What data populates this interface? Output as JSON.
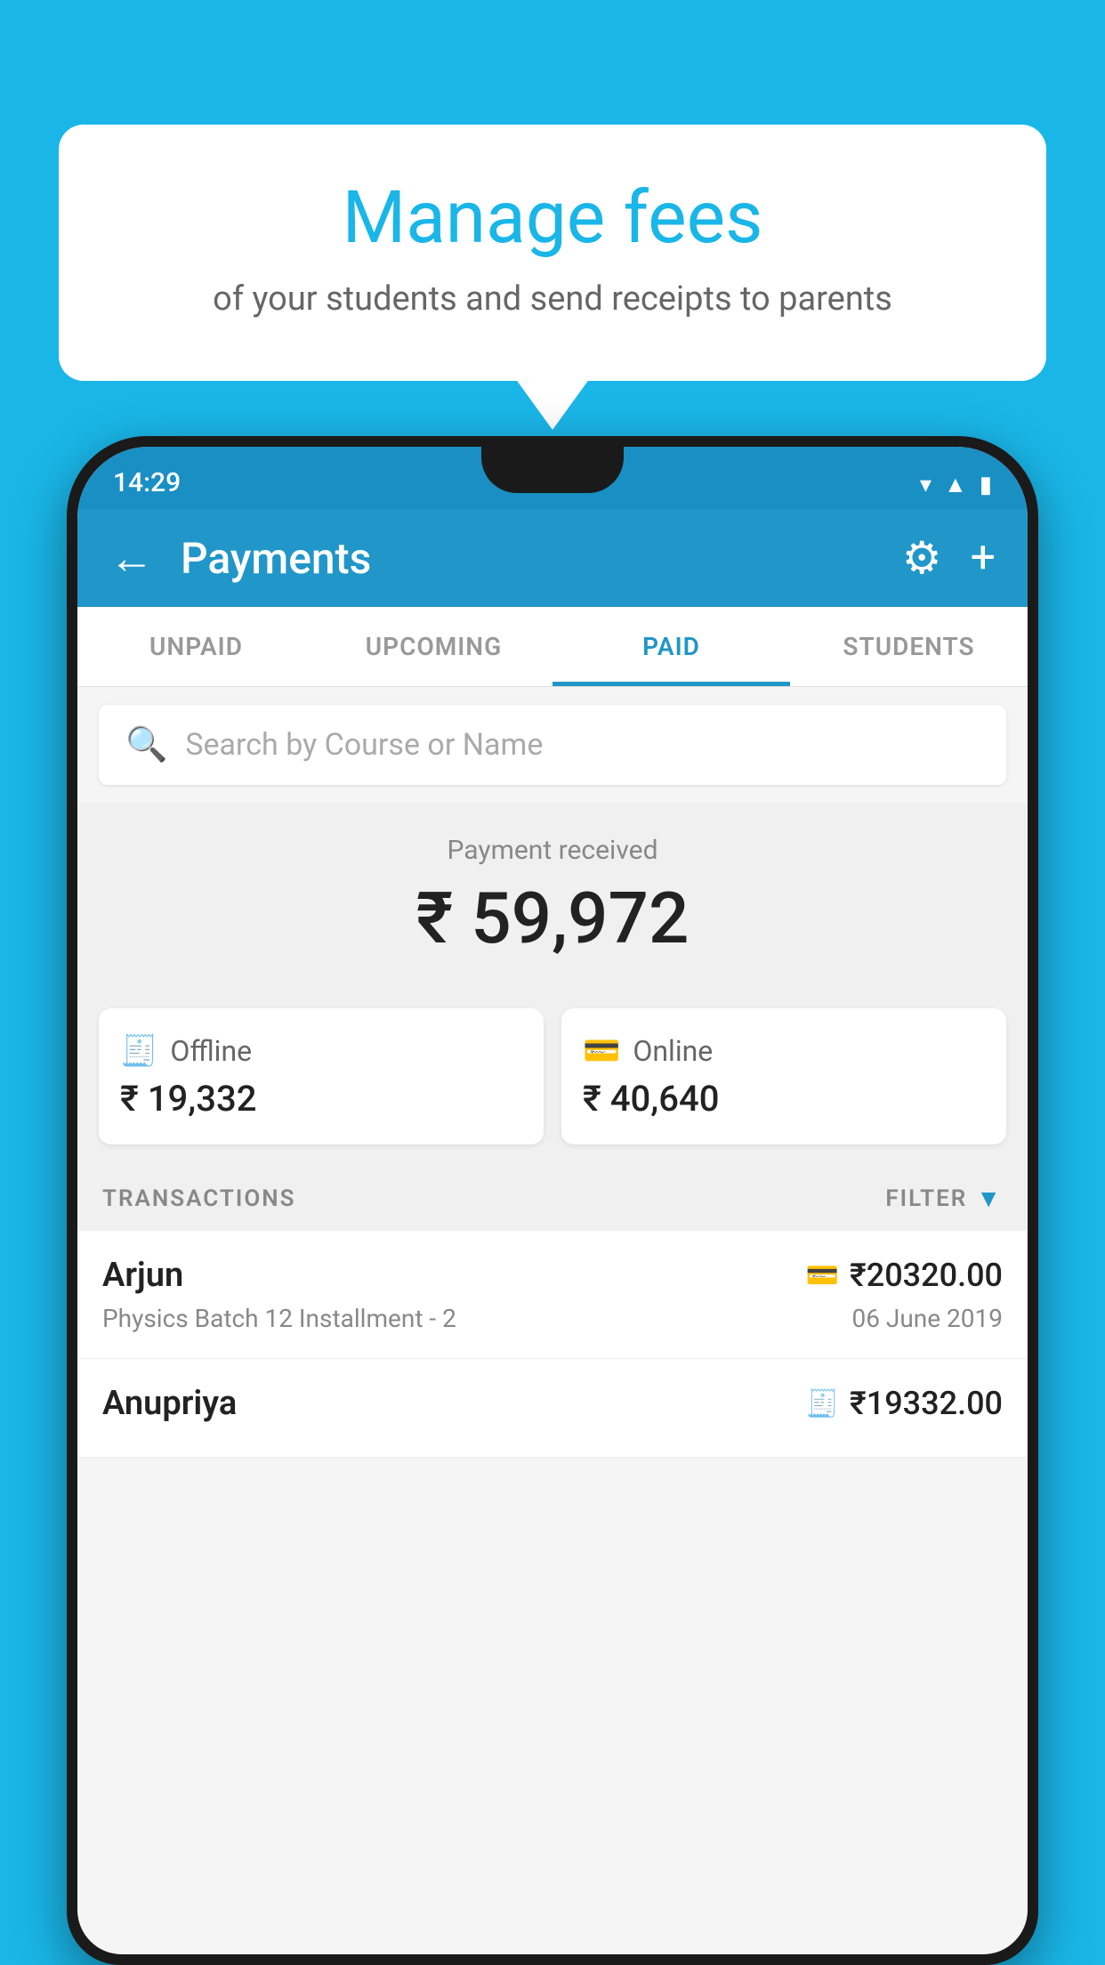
{
  "background_color": "#1ab6e8",
  "speech_bubble": {
    "title": "Manage fees",
    "subtitle": "of your students and send receipts to parents"
  },
  "status_bar": {
    "time": "14:29",
    "icons": [
      "wifi",
      "signal",
      "battery"
    ]
  },
  "app_bar": {
    "title": "Payments",
    "back_label": "←",
    "gear_label": "⚙",
    "plus_label": "+"
  },
  "tabs": [
    {
      "label": "UNPAID",
      "active": false
    },
    {
      "label": "UPCOMING",
      "active": false
    },
    {
      "label": "PAID",
      "active": true
    },
    {
      "label": "STUDENTS",
      "active": false
    }
  ],
  "search": {
    "placeholder": "Search by Course or Name"
  },
  "payment_summary": {
    "label": "Payment received",
    "amount": "₹ 59,972"
  },
  "payment_cards": [
    {
      "label": "Offline",
      "amount": "₹ 19,332",
      "icon": "💳"
    },
    {
      "label": "Online",
      "amount": "₹ 40,640",
      "icon": "💳"
    }
  ],
  "transactions_section": {
    "label": "TRANSACTIONS",
    "filter_label": "FILTER"
  },
  "transactions": [
    {
      "name": "Arjun",
      "course": "Physics Batch 12 Installment - 2",
      "amount": "₹20320.00",
      "date": "06 June 2019",
      "payment_type": "online"
    },
    {
      "name": "Anupriya",
      "course": "",
      "amount": "₹19332.00",
      "date": "",
      "payment_type": "offline"
    }
  ]
}
